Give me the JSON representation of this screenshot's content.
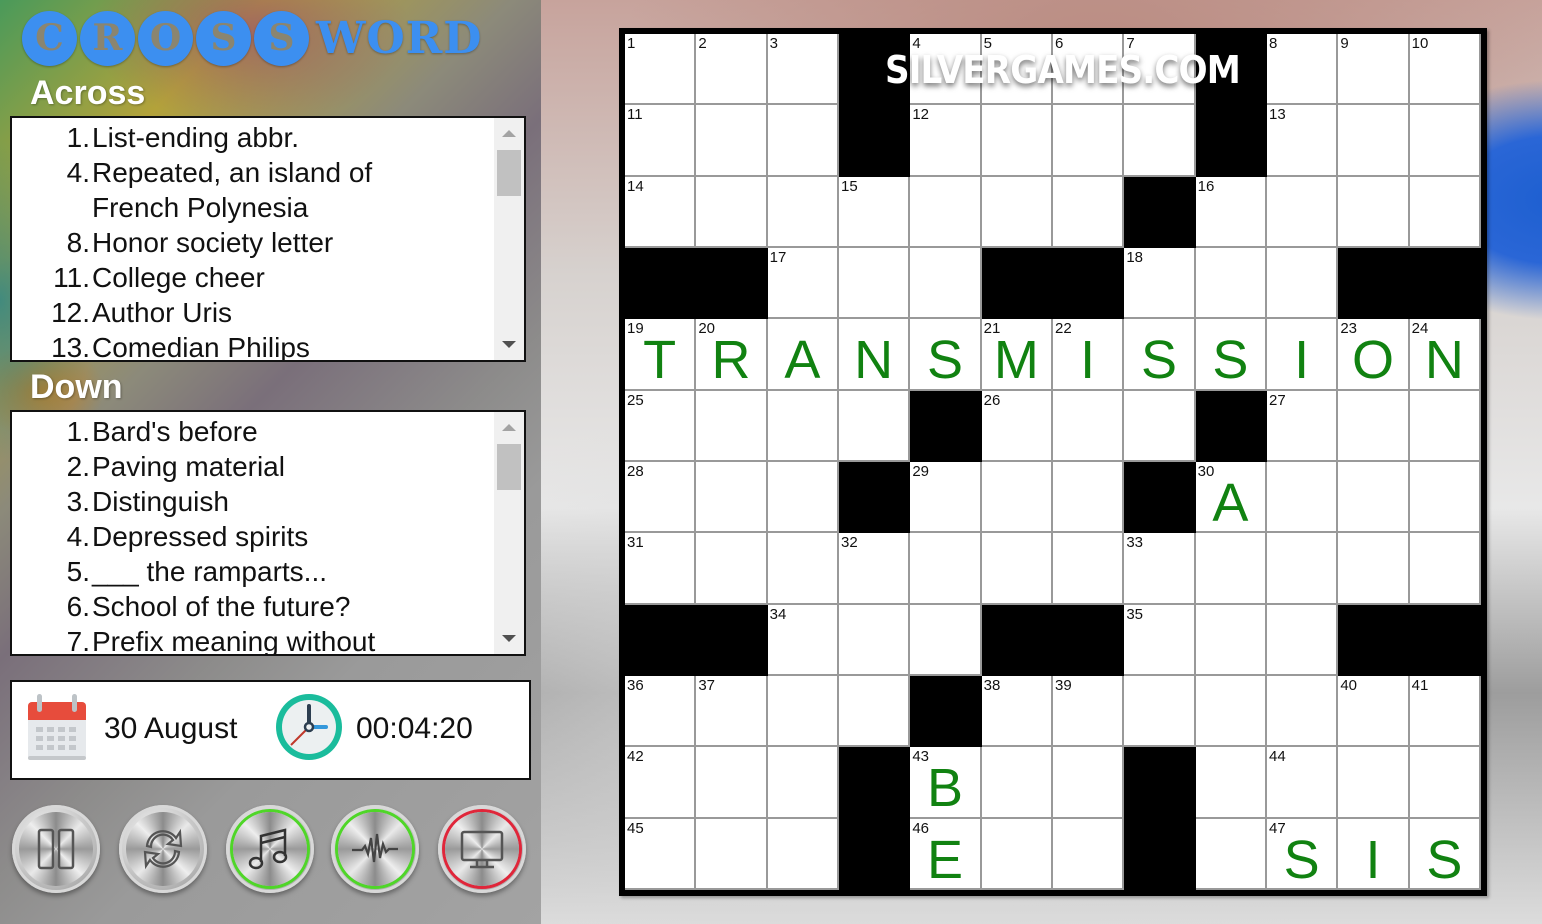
{
  "app": {
    "logo_circles": [
      "C",
      "R",
      "O",
      "S",
      "S"
    ],
    "logo_word": "WORD",
    "watermark": "SILVERGAMES.COM"
  },
  "across": {
    "title": "Across",
    "clues": [
      {
        "num": "1.",
        "text": "List-ending abbr."
      },
      {
        "num": "4.",
        "text": "Repeated, an island of"
      },
      {
        "num": "",
        "text": "French Polynesia"
      },
      {
        "num": "8.",
        "text": "Honor society letter"
      },
      {
        "num": "11.",
        "text": "College cheer"
      },
      {
        "num": "12.",
        "text": "Author Uris"
      },
      {
        "num": "13.",
        "text": "Comedian Philips"
      }
    ]
  },
  "down": {
    "title": "Down",
    "clues": [
      {
        "num": "1.",
        "text": "Bard's before"
      },
      {
        "num": "2.",
        "text": "Paving material"
      },
      {
        "num": "3.",
        "text": "Distinguish"
      },
      {
        "num": "4.",
        "text": "Depressed spirits"
      },
      {
        "num": "5.",
        "text": "___ the ramparts..."
      },
      {
        "num": "6.",
        "text": "School of the future?"
      },
      {
        "num": "7.",
        "text": "Prefix meaning without"
      }
    ]
  },
  "info": {
    "date": "30 August",
    "timer": "00:04:20"
  },
  "controls": [
    {
      "name": "pause",
      "icon": "pause-icon"
    },
    {
      "name": "restart",
      "icon": "refresh-icon"
    },
    {
      "name": "music",
      "icon": "music-note-icon",
      "state": "on"
    },
    {
      "name": "sound",
      "icon": "sound-wave-icon",
      "state": "on"
    },
    {
      "name": "fullscreen",
      "icon": "monitor-icon",
      "state": "off"
    }
  ],
  "colors": {
    "letter": "#118211",
    "sound_on_ring": "#4fd628",
    "off_ring": "#e0263a",
    "logo_blue": "#3c8ff0"
  },
  "grid": {
    "size": 12,
    "layout": [
      "...#....#...",
      "...#....#...",
      ".......#....",
      "##...##...##",
      "............",
      "....#...#...",
      "...#...#....",
      "............",
      "##...##...##",
      "....#.......",
      "...#...#....",
      "...#...#...."
    ],
    "numbers": [
      [
        1,
        2,
        3,
        0,
        4,
        5,
        6,
        7,
        0,
        8,
        9,
        10
      ],
      [
        11,
        0,
        0,
        0,
        12,
        0,
        0,
        0,
        0,
        13,
        0,
        0
      ],
      [
        14,
        0,
        0,
        15,
        0,
        0,
        0,
        0,
        16,
        0,
        0,
        0
      ],
      [
        0,
        0,
        17,
        0,
        0,
        0,
        0,
        18,
        0,
        0,
        0,
        0
      ],
      [
        19,
        20,
        0,
        0,
        0,
        21,
        22,
        0,
        0,
        0,
        23,
        24
      ],
      [
        25,
        0,
        0,
        0,
        0,
        26,
        0,
        0,
        0,
        27,
        0,
        0
      ],
      [
        28,
        0,
        0,
        0,
        29,
        0,
        0,
        0,
        30,
        0,
        0,
        0
      ],
      [
        31,
        0,
        0,
        32,
        0,
        0,
        0,
        33,
        0,
        0,
        0,
        0
      ],
      [
        0,
        0,
        34,
        0,
        0,
        0,
        0,
        35,
        0,
        0,
        0,
        0
      ],
      [
        36,
        37,
        0,
        0,
        0,
        38,
        39,
        0,
        0,
        0,
        40,
        41
      ],
      [
        42,
        0,
        0,
        0,
        43,
        0,
        0,
        0,
        0,
        44,
        0,
        0
      ],
      [
        45,
        0,
        0,
        0,
        46,
        0,
        0,
        0,
        0,
        47,
        0,
        0
      ]
    ],
    "letters": [
      "            ",
      "            ",
      "            ",
      "            ",
      "TRANSMISSION",
      "            ",
      "        A   ",
      "            ",
      "            ",
      "            ",
      "    B       ",
      "    E    SIS"
    ]
  }
}
